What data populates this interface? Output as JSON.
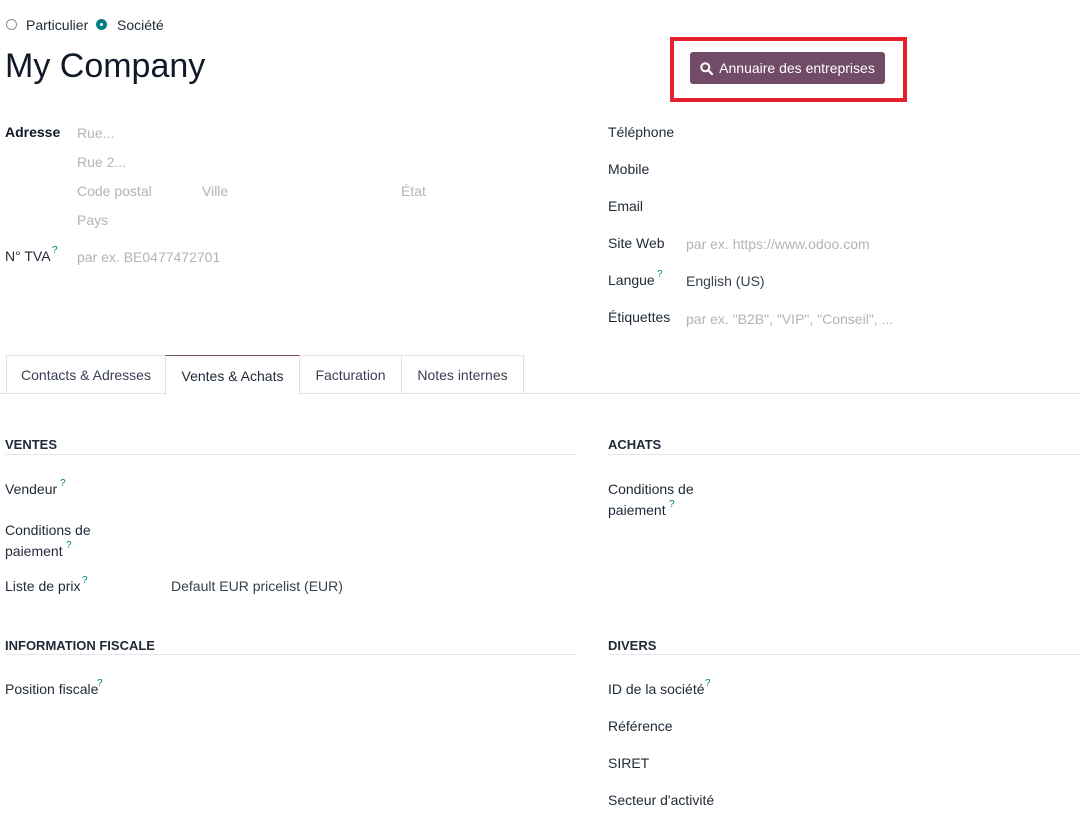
{
  "company_type": {
    "options": [
      {
        "label": "Particulier",
        "checked": false
      },
      {
        "label": "Société",
        "checked": true
      }
    ]
  },
  "name": "My Company",
  "directory_button": {
    "label": "Annuaire des entreprises",
    "icon": "search-icon"
  },
  "address": {
    "label": "Adresse",
    "street_placeholder": "Rue...",
    "street2_placeholder": "Rue 2...",
    "zip_placeholder": "Code postal",
    "city_placeholder": "Ville",
    "state_placeholder": "État",
    "country_placeholder": "Pays"
  },
  "vat": {
    "label": "N° TVA",
    "help": "?",
    "placeholder": "par ex. BE0477472701"
  },
  "contact": {
    "phone_label": "Téléphone",
    "mobile_label": "Mobile",
    "email_label": "Email",
    "website_label": "Site Web",
    "website_placeholder": "par ex. https://www.odoo.com",
    "language_label": "Langue",
    "language_help": "?",
    "language_value": "English (US)",
    "tags_label": "Étiquettes",
    "tags_placeholder": "par ex. \"B2B\", \"VIP\", \"Conseil\", ..."
  },
  "tabs": [
    {
      "label": "Contacts & Adresses",
      "active": false
    },
    {
      "label": "Ventes & Achats",
      "active": true
    },
    {
      "label": "Facturation",
      "active": false
    },
    {
      "label": "Notes internes",
      "active": false
    }
  ],
  "sales": {
    "title": "VENTES",
    "salesperson_label": "Vendeur",
    "payment_terms_label_1": "Conditions de",
    "payment_terms_label_2": "paiement",
    "pricelist_label": "Liste de prix",
    "pricelist_value": "Default EUR pricelist (EUR)",
    "help": "?"
  },
  "purchases": {
    "title": "ACHATS",
    "payment_terms_label_1": "Conditions de",
    "payment_terms_label_2": "paiement",
    "help": "?"
  },
  "fiscal": {
    "title": "INFORMATION FISCALE",
    "fiscal_position_label": "Position fiscale",
    "help": "?"
  },
  "misc": {
    "title": "DIVERS",
    "company_id_label": "ID de la société",
    "reference_label": "Référence",
    "siret_label": "SIRET",
    "industry_label": "Secteur d'activité",
    "help": "?"
  },
  "colors": {
    "accent": "#714b67",
    "radio": "#017e84",
    "highlight": "#e3202b"
  }
}
